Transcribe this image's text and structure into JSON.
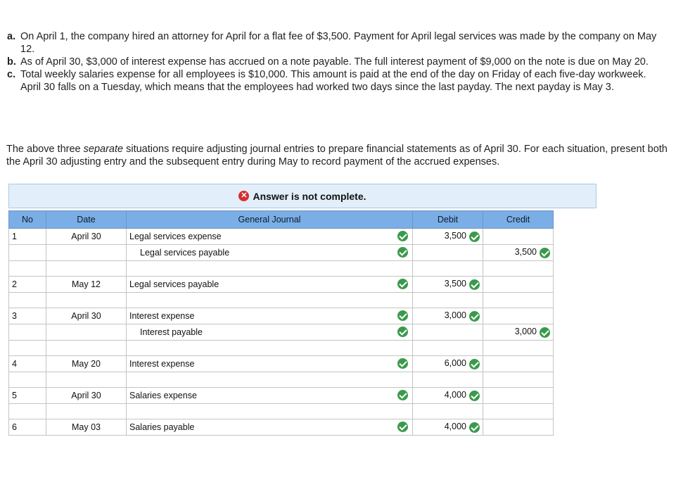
{
  "problem": {
    "items": [
      {
        "letter": "a.",
        "text": "On April 1, the company hired an attorney for April for a flat fee of $3,500. Payment for April legal services was made by the company on May 12."
      },
      {
        "letter": "b.",
        "text": "As of April 30, $3,000 of interest expense has accrued on a note payable. The full interest payment of $9,000 on the note is due on May 20."
      },
      {
        "letter": "c.",
        "text": "Total weekly salaries expense for all employees is $10,000. This amount is paid at the end of the day on Friday of each five-day workweek. April 30 falls on a Tuesday, which means that the employees had worked two days since the last payday. The next payday is May 3."
      }
    ],
    "instructions_before": "The above three ",
    "instructions_em": "separate",
    "instructions_after": " situations require adjusting journal entries to prepare financial statements as of April 30. For each situation, present both the April 30 adjusting entry and the subsequent entry during May to record payment of the accrued expenses."
  },
  "banner": {
    "icon": "x-circle-icon",
    "text": "Answer is not complete.",
    "color": "#d32f2f"
  },
  "journal": {
    "headers": {
      "no": "No",
      "date": "Date",
      "general_journal": "General Journal",
      "debit": "Debit",
      "credit": "Credit"
    },
    "header_color": "#7baee6",
    "check_color": "#3a9a4c",
    "entries": [
      {
        "no": "1",
        "date": "April 30",
        "lines": [
          {
            "account": "Legal services expense",
            "debit": "3,500",
            "credit": "",
            "indent": false
          },
          {
            "account": "Legal services payable",
            "debit": "",
            "credit": "3,500",
            "indent": true
          }
        ]
      },
      {
        "no": "2",
        "date": "May 12",
        "lines": [
          {
            "account": "Legal services payable",
            "debit": "3,500",
            "credit": "",
            "indent": false
          }
        ]
      },
      {
        "no": "3",
        "date": "April 30",
        "lines": [
          {
            "account": "Interest expense",
            "debit": "3,000",
            "credit": "",
            "indent": false
          },
          {
            "account": "Interest payable",
            "debit": "",
            "credit": "3,000",
            "indent": true
          }
        ]
      },
      {
        "no": "4",
        "date": "May 20",
        "lines": [
          {
            "account": "Interest expense",
            "debit": "6,000",
            "credit": "",
            "indent": false
          }
        ]
      },
      {
        "no": "5",
        "date": "April 30",
        "lines": [
          {
            "account": "Salaries expense",
            "debit": "4,000",
            "credit": "",
            "indent": false
          }
        ]
      },
      {
        "no": "6",
        "date": "May 03",
        "lines": [
          {
            "account": "Salaries payable",
            "debit": "4,000",
            "credit": "",
            "indent": false
          }
        ]
      }
    ]
  }
}
